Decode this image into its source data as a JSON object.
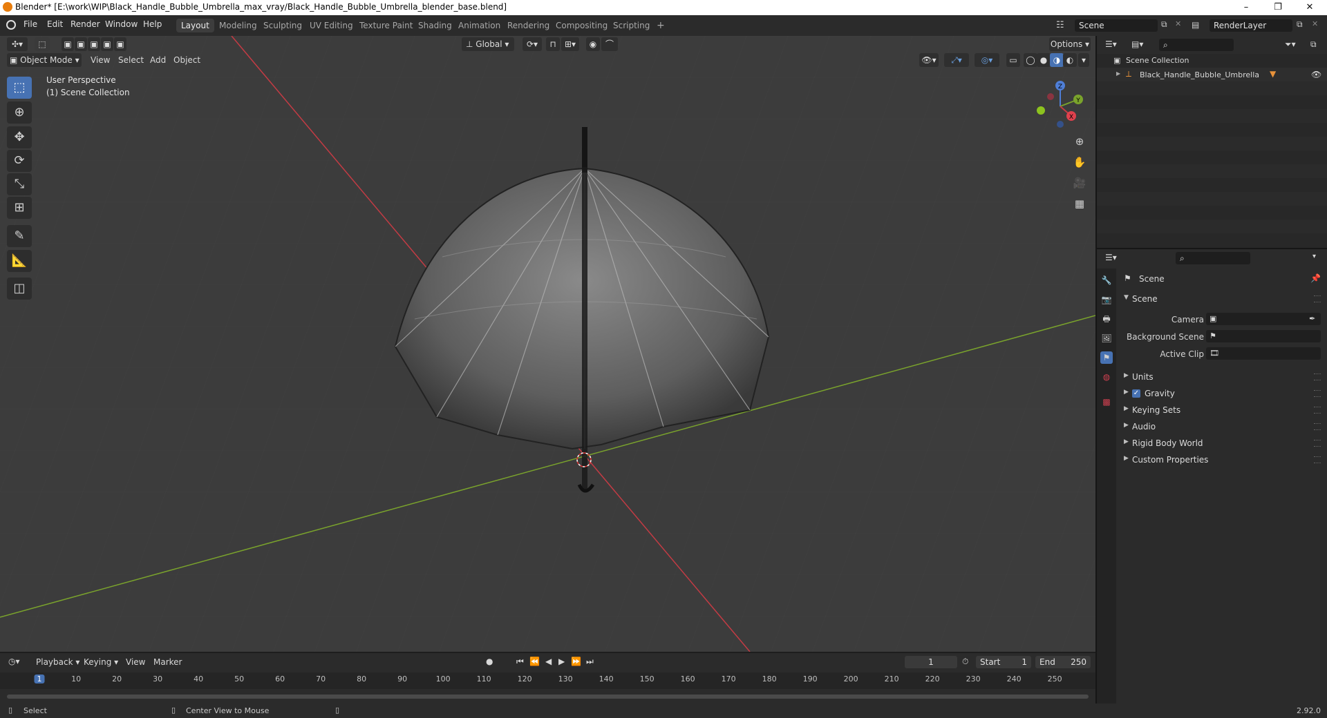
{
  "window": {
    "title": "Blender* [E:\\work\\WIP\\Black_Handle_Bubble_Umbrella_max_vray/Black_Handle_Bubble_Umbrella_blender_base.blend]",
    "minimize": "–",
    "restore": "❐",
    "close": "✕"
  },
  "menu": [
    "File",
    "Edit",
    "Render",
    "Window",
    "Help"
  ],
  "workspaces": [
    "Layout",
    "Modeling",
    "Sculpting",
    "UV Editing",
    "Texture Paint",
    "Shading",
    "Animation",
    "Rendering",
    "Compositing",
    "Scripting"
  ],
  "workspace_add": "+",
  "scene_field": "Scene",
  "render_layer_field": "RenderLayer",
  "viewport": {
    "transform_orientation": "Global",
    "options": "Options",
    "mode": "Object Mode",
    "menus": [
      "View",
      "Select",
      "Add",
      "Object"
    ],
    "overlay_line1": "User Perspective",
    "overlay_line2": "(1) Scene Collection",
    "gizmo": {
      "x": "X",
      "y": "Y",
      "z": "Z"
    }
  },
  "outliner": {
    "root": "Scene Collection",
    "items": [
      {
        "label": "Black_Handle_Bubble_Umbrella"
      }
    ]
  },
  "properties": {
    "header_title": "Scene",
    "section": "Scene",
    "fields": [
      {
        "label": "Camera",
        "value": ""
      },
      {
        "label": "Background Scene",
        "value": ""
      },
      {
        "label": "Active Clip",
        "value": ""
      }
    ],
    "panels": [
      "Units",
      "Gravity",
      "Keying Sets",
      "Audio",
      "Rigid Body World",
      "Custom Properties"
    ],
    "gravity_checked": true
  },
  "timeline": {
    "menus": [
      "Playback",
      "Keying",
      "View",
      "Marker"
    ],
    "current_frame": "1",
    "start_label": "Start",
    "start": "1",
    "end_label": "End",
    "end": "250",
    "ruler": [
      "1",
      "10",
      "20",
      "30",
      "40",
      "50",
      "60",
      "70",
      "80",
      "90",
      "100",
      "110",
      "120",
      "130",
      "140",
      "150",
      "160",
      "170",
      "180",
      "190",
      "200",
      "210",
      "220",
      "230",
      "240",
      "250"
    ]
  },
  "statusbar": {
    "left": "Select",
    "middle": "Center View to Mouse",
    "version": "2.92.0"
  },
  "colors": {
    "accent": "#4772b3",
    "x_axis": "#c43b44",
    "y_axis": "#7aa32c",
    "viewport_bg": "#3c3c3c",
    "panel_bg": "#2b2b2b"
  }
}
